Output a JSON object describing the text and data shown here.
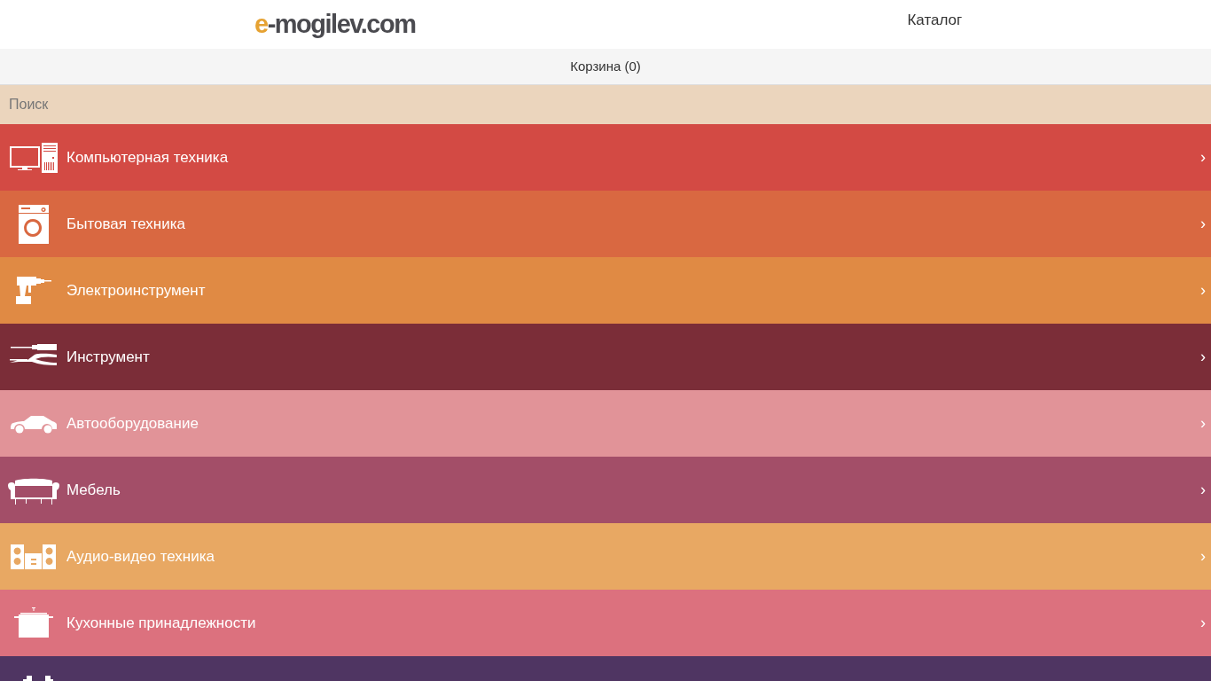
{
  "header": {
    "logo": {
      "accent": "e",
      "rest": "-mogilev.com"
    },
    "nav": "Каталог"
  },
  "cart_bar": {
    "label": "Корзина (0)"
  },
  "search": {
    "placeholder": "Поиск"
  },
  "categories": [
    {
      "kind": "computer",
      "label": "Компьютерная техника",
      "color": "#d34a44",
      "chevron": "›"
    },
    {
      "kind": "washer",
      "label": "Бытовая техника",
      "color": "#d96841",
      "chevron": "›"
    },
    {
      "kind": "drill",
      "label": "Электроинструмент",
      "color": "#e08a44",
      "chevron": "›"
    },
    {
      "kind": "tools",
      "label": "Инструмент",
      "color": "#7b2d38",
      "chevron": "›"
    },
    {
      "kind": "car",
      "label": "Автооборудование",
      "color": "#e19398",
      "chevron": "›"
    },
    {
      "kind": "sofa",
      "label": "Мебель",
      "color": "#a34e68",
      "chevron": "›"
    },
    {
      "kind": "audio",
      "label": "Аудио-видео техника",
      "color": "#e8a863",
      "chevron": "›"
    },
    {
      "kind": "pot",
      "label": "Кухонные принадлежности",
      "color": "#dc717e",
      "chevron": "›"
    },
    {
      "kind": "dumbbell",
      "color": "#4f3562"
    }
  ]
}
